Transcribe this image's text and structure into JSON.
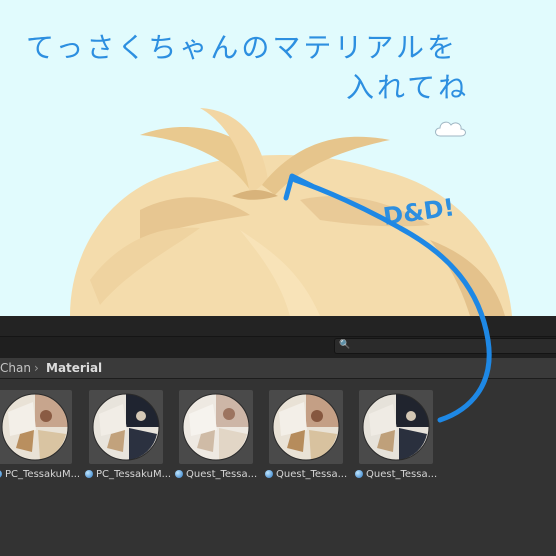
{
  "instruction": {
    "line1": "てっさくちゃんのマテリアルを",
    "line2": "入れてね"
  },
  "drag_hint": "D&D!",
  "project": {
    "breadcrumb": [
      "Chan",
      "Material"
    ],
    "search": {
      "placeholder": ""
    }
  },
  "assets": [
    {
      "name": "PC_TessakuM...",
      "style": "light"
    },
    {
      "name": "PC_TessakuM...",
      "style": "dark"
    },
    {
      "name": "Quest_Tessa...",
      "style": "pale"
    },
    {
      "name": "Quest_Tessa...",
      "style": "light"
    },
    {
      "name": "Quest_Tessa...",
      "style": "dark"
    }
  ],
  "colors": {
    "viewport_bg": "#e1fbfd",
    "hair": "#f5d9a6",
    "hair_shadow": "#d9b57e",
    "annotation_blue": "#2d8fe0",
    "panel_bg": "#333333"
  }
}
